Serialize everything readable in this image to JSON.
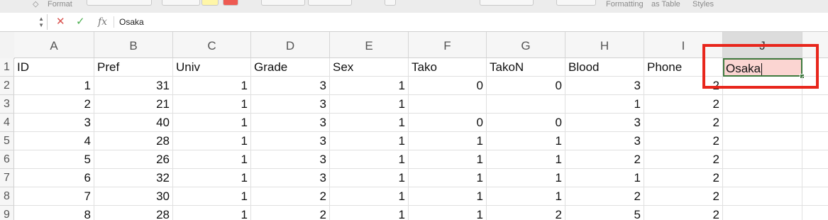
{
  "ribbon": {
    "format_label": "Format",
    "formatting_label": "Formatting",
    "as_table_label": "as Table",
    "styles_label": "Styles"
  },
  "formula_bar": {
    "fx_label": "fx",
    "value": "Osaka"
  },
  "columns": [
    "A",
    "B",
    "C",
    "D",
    "E",
    "F",
    "G",
    "H",
    "I",
    "J"
  ],
  "selected_column": "J",
  "header_row": {
    "row_label": "1",
    "cells": [
      "ID",
      "Pref",
      "Univ",
      "Grade",
      "Sex",
      "Tako",
      "TakoN",
      "Blood",
      "Phone",
      "Osaka"
    ]
  },
  "rows": [
    {
      "row_label": "2",
      "cells": [
        "1",
        "31",
        "1",
        "3",
        "1",
        "0",
        "0",
        "3",
        "2",
        ""
      ]
    },
    {
      "row_label": "3",
      "cells": [
        "2",
        "21",
        "1",
        "3",
        "1",
        "",
        "",
        "1",
        "2",
        ""
      ]
    },
    {
      "row_label": "4",
      "cells": [
        "3",
        "40",
        "1",
        "3",
        "1",
        "0",
        "0",
        "3",
        "2",
        ""
      ]
    },
    {
      "row_label": "5",
      "cells": [
        "4",
        "28",
        "1",
        "3",
        "1",
        "1",
        "1",
        "3",
        "2",
        ""
      ]
    },
    {
      "row_label": "6",
      "cells": [
        "5",
        "26",
        "1",
        "3",
        "1",
        "1",
        "1",
        "2",
        "2",
        ""
      ]
    },
    {
      "row_label": "7",
      "cells": [
        "6",
        "32",
        "1",
        "3",
        "1",
        "1",
        "1",
        "1",
        "2",
        ""
      ]
    },
    {
      "row_label": "8",
      "cells": [
        "7",
        "30",
        "1",
        "2",
        "1",
        "1",
        "1",
        "2",
        "2",
        ""
      ]
    },
    {
      "row_label": "9",
      "cells": [
        "8",
        "28",
        "1",
        "2",
        "1",
        "1",
        "2",
        "5",
        "2",
        ""
      ]
    }
  ],
  "colors": {
    "active_cell_fill": "#fbd5d2",
    "active_cell_border": "#3f7a3f",
    "highlight_box": "#e8261c",
    "cancel_icon": "#d9534f",
    "enter_icon": "#4caf50"
  }
}
